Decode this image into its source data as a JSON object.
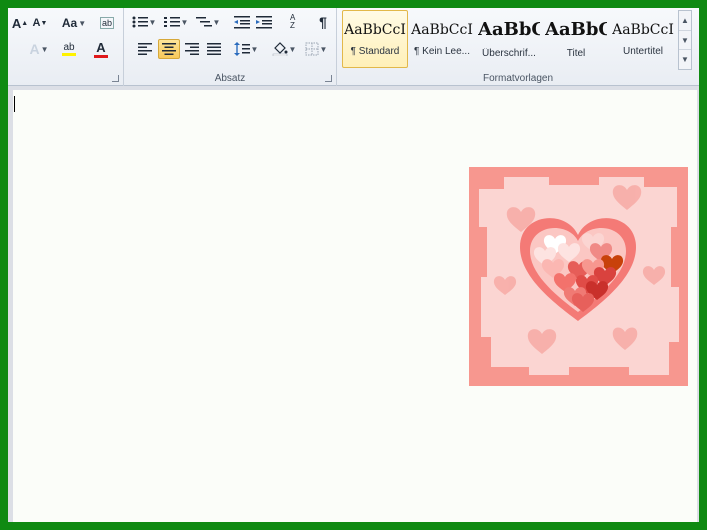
{
  "ribbon": {
    "font_group": {
      "grow_font": "A",
      "shrink_font": "A",
      "change_case": "Aa",
      "clear_format": "ab",
      "text_effects": "A",
      "highlight": "ab",
      "font_color": "A"
    },
    "paragraph_group": {
      "label": "Absatz",
      "sort": "A Z",
      "pilcrow": "¶"
    },
    "styles_group": {
      "label": "Formatvorlagen",
      "styles": [
        {
          "sample": "AaBbCcI",
          "name": "¶ Standard"
        },
        {
          "sample": "AaBbCcI",
          "name": "¶ Kein Lee..."
        },
        {
          "sample": "AaBbC",
          "name": "Überschrif..."
        },
        {
          "sample": "AaBbC",
          "name": "Titel"
        },
        {
          "sample": "AaBbCcI",
          "name": "Untertitel"
        }
      ]
    }
  },
  "colors": {
    "window_border": "#0f8a12",
    "picture_frame": "#f7978f",
    "picture_inner": "#fbd5d2",
    "heart": "#f47a76"
  }
}
